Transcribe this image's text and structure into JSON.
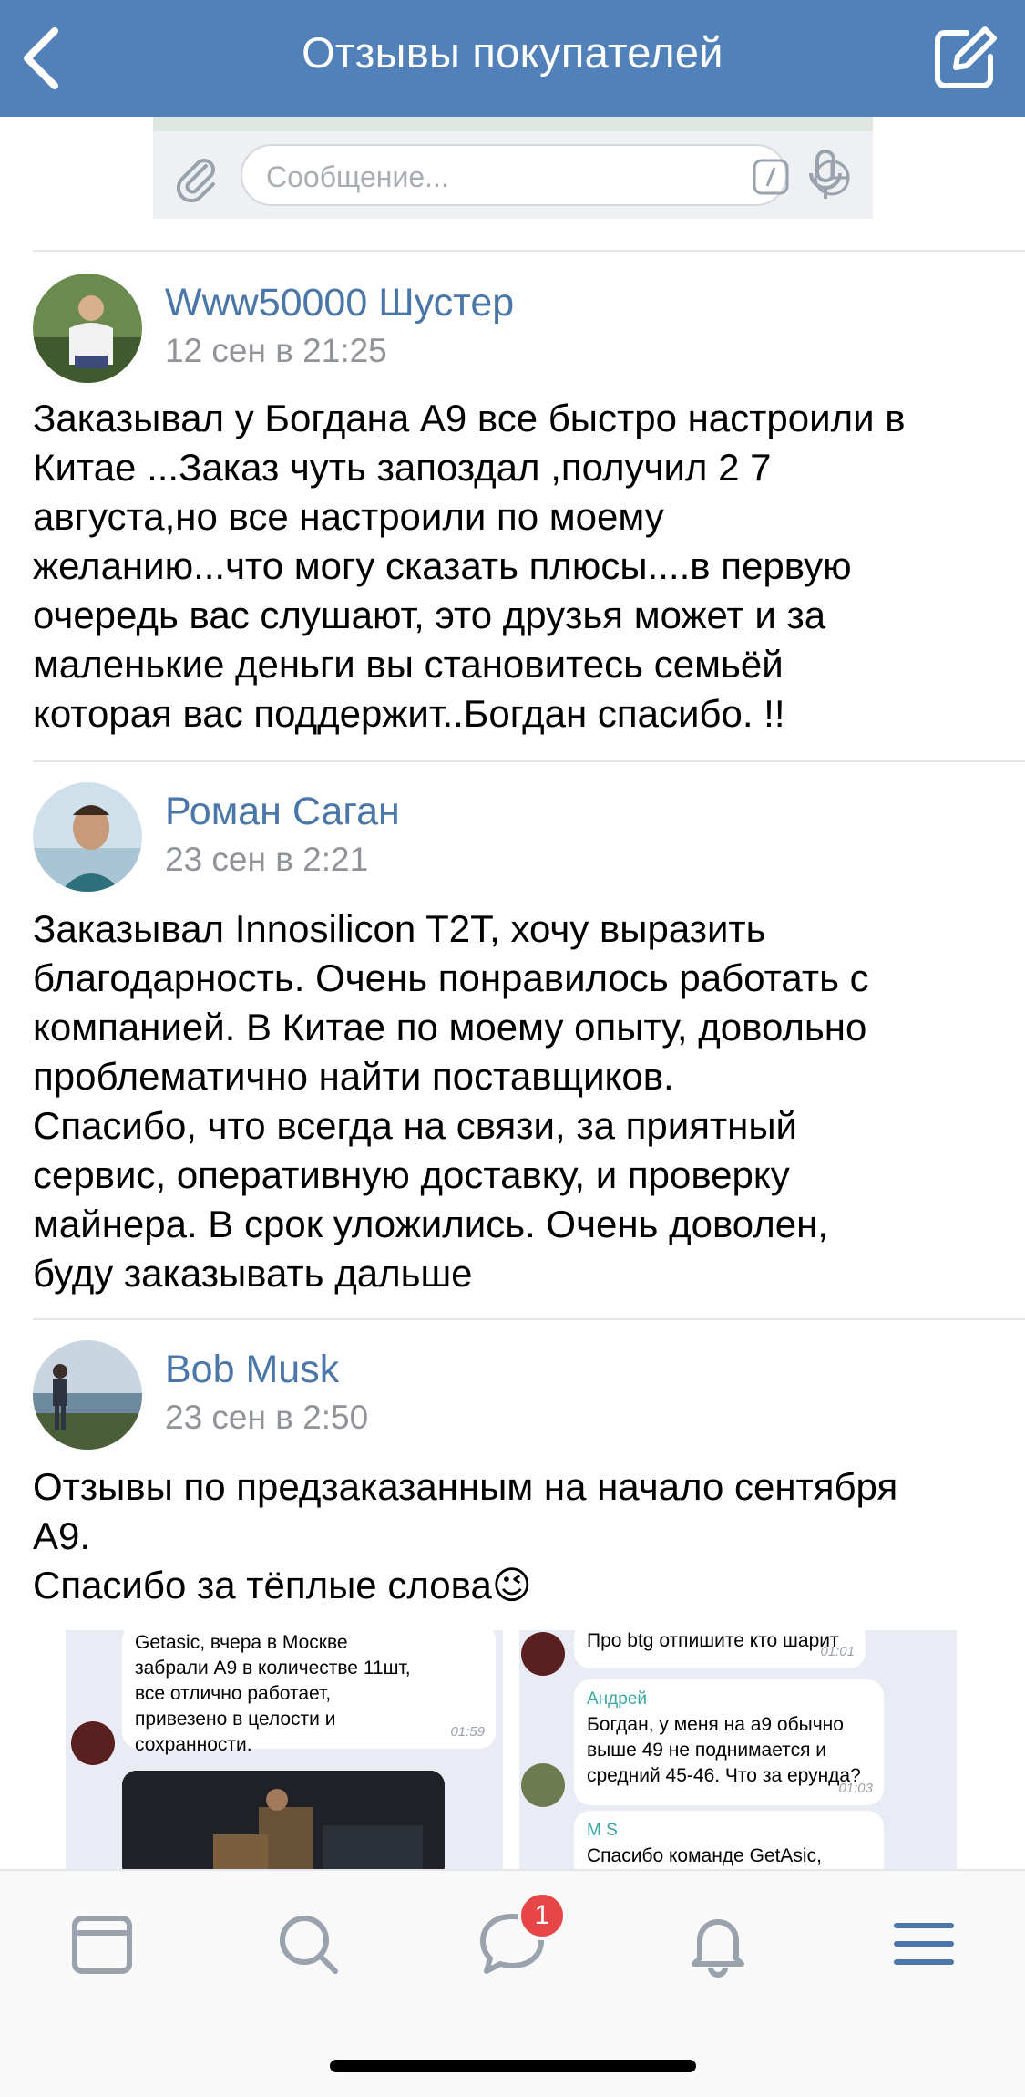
{
  "header": {
    "title": "Отзывы покупателей",
    "back_icon": "chevron-left-icon",
    "edit_icon": "compose-icon",
    "color": "#5181b8"
  },
  "message_bar": {
    "placeholder": "Сообщение..."
  },
  "posts": [
    {
      "author": "Www50000 Шустер",
      "time": "12 сен в 21:25",
      "text": "Заказывал у Богдана А9 все быстро настроили в\nКитае ...Заказ чуть запоздал ,получил 2 7\nавгуста,но все настроили по моему\nжеланию...что могу сказать плюсы....в первую\nочередь вас слушают, это друзья может и за\nмаленькие деньги вы становитесь семьёй\nкоторая вас поддержит..Богдан спасибо. !!"
    },
    {
      "author": "Роман Саган",
      "time": "23 сен в 2:21",
      "text": "Заказывал Innosilicon T2T, хочу выразить\nблагодарность. Очень понравилось работать с\nкомпанией. В Китае по моему опыту, довольно\nпроблематично найти поставщиков.\nСпасибо, что всегда на связи, за приятный\nсервис, оперативную доставку, и проверку\nмайнера. В срок уложились. Очень доволен,\nбуду заказывать дальше"
    },
    {
      "author": "Bob Musk",
      "time": "23 сен в 2:50",
      "text": "Отзывы по предзаказанным на начало сентября\nA9.\nСпасибо за тёплые слова😉"
    }
  ],
  "attachments": {
    "left": {
      "message": "Getasic, вчера в Москве\nзабрали А9 в количестве 11шт,\nвсе отлично работает,\nпривезено в целости и\nсохранности.",
      "time": "01:59"
    },
    "right": {
      "msg1": "Про btg отпишите кто шарит",
      "msg1_time": "01:01",
      "msg2_sender": "Андрей",
      "msg2": "Богдан, у меня на а9 обычно\nвыше 49 не поднимается и\nсредний 45-46. Что за ерунда?",
      "msg2_time": "01:03",
      "msg3_sender": "M S",
      "msg3": "Спасибо команде GetAsic,"
    }
  },
  "tabbar": {
    "items": [
      "feed-icon",
      "search-icon",
      "messages-icon",
      "notifications-icon",
      "menu-icon"
    ],
    "badge": "1",
    "active_color": "#4a76a8",
    "inactive_color": "#99a2ad"
  }
}
